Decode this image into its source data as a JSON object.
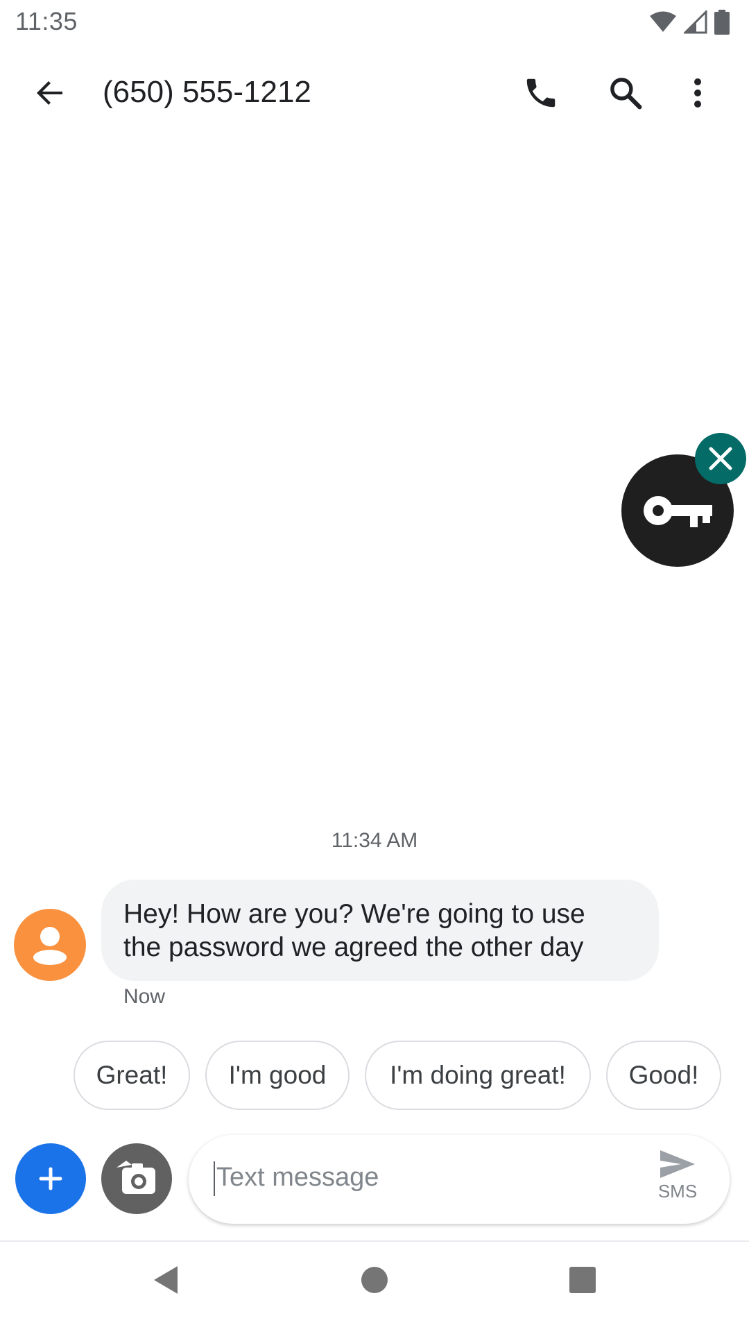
{
  "status_bar": {
    "time": "11:35",
    "icons": [
      "wifi-icon",
      "signal-icon",
      "battery-icon"
    ]
  },
  "app_bar": {
    "title": "(650) 555-1212",
    "actions": [
      "back-arrow-icon",
      "phone-icon",
      "search-icon",
      "more-vert-icon"
    ]
  },
  "key_bubble": {
    "icon": "key-icon",
    "close_icon": "close-icon",
    "accent": "#046b67"
  },
  "conversation": {
    "timestamp": "11:34 AM",
    "message": {
      "line1": "Hey! How are you? We're going to use",
      "line2": "the password we agreed the other day",
      "status": "Now",
      "avatar_color": "#f9913f"
    }
  },
  "smart_replies": [
    "Great!",
    "I'm good",
    "I'm doing great!",
    "Good!"
  ],
  "compose": {
    "placeholder": "Text message",
    "send_label": "SMS",
    "plus_color": "#1a73e8"
  },
  "nav_bar": [
    "nav-back-icon",
    "nav-home-icon",
    "nav-recents-icon"
  ]
}
